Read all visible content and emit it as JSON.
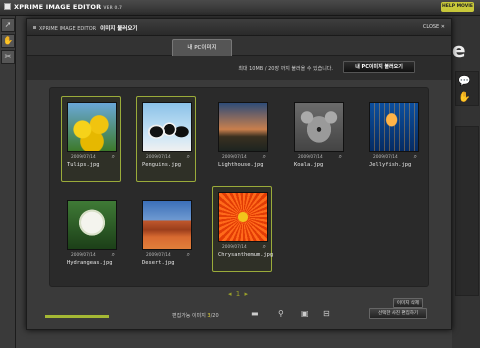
{
  "app": {
    "logo": "XPRIME IMAGE EDITOR",
    "version": "VER 0.7",
    "help_button": "HELP MOVIE"
  },
  "dialog": {
    "app_name": "XPRIME IMAGE EDITOR",
    "title": "이미지 불러오기",
    "close_label": "CLOSE ✕",
    "tab_label": "내 PC이미지",
    "info_message": "최대 10MB / 20장 까지 불러올 수 있습니다.",
    "load_button": "내 PC이미지 불러오기",
    "delete_button": "이미지 삭제",
    "edit_button": "선택한 사진 편집하기",
    "editable_count_label": "편집가능 이미지",
    "editable_count": "3",
    "editable_total": "/20",
    "pager": {
      "prev": "◂",
      "page": "1",
      "next": "▸",
      "dots": "• •"
    }
  },
  "images": [
    {
      "name": "Tulips.jpg",
      "date": "2009/07/14",
      "selected": true
    },
    {
      "name": "Penguins.jpg",
      "date": "2009/07/14",
      "selected": true
    },
    {
      "name": "Lighthouse.jpg",
      "date": "2009/07/14",
      "selected": false
    },
    {
      "name": "Koala.jpg",
      "date": "2009/07/14",
      "selected": false
    },
    {
      "name": "Jellyfish.jpg",
      "date": "2009/07/14",
      "selected": false
    },
    {
      "name": "Hydrangeas.jpg",
      "date": "2009/07/14",
      "selected": false
    },
    {
      "name": "Desert.jpg",
      "date": "2009/07/14",
      "selected": false
    },
    {
      "name": "Chrysanthemum.jpg",
      "date": "2009/07/14",
      "selected": true
    }
  ],
  "colors": {
    "accent": "#a4b834",
    "selection_border": "#9aab3a"
  }
}
